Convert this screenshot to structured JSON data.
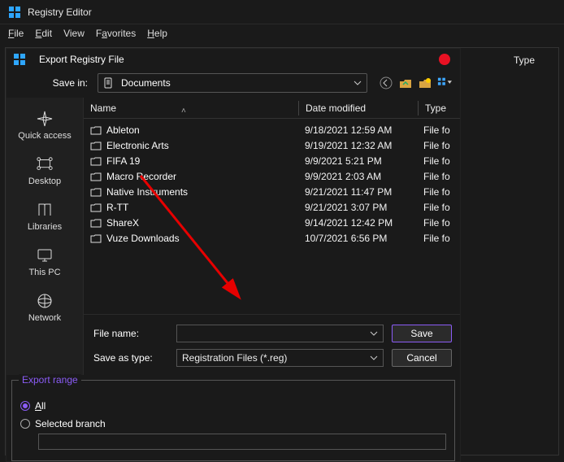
{
  "app": {
    "title": "Registry Editor"
  },
  "menu": {
    "file": "File",
    "edit": "Edit",
    "view": "View",
    "favorites": "Favorites",
    "help": "Help"
  },
  "dialog": {
    "title": "Export Registry File",
    "save_in_label": "Save in:",
    "save_in_value": "Documents",
    "columns": {
      "name": "Name",
      "date": "Date modified",
      "type": "Type"
    },
    "places": {
      "quick_access": "Quick access",
      "desktop": "Desktop",
      "libraries": "Libraries",
      "this_pc": "This PC",
      "network": "Network"
    },
    "rows": [
      {
        "name": "Ableton",
        "date": "9/18/2021 12:59 AM",
        "type": "File fo"
      },
      {
        "name": "Electronic Arts",
        "date": "9/19/2021 12:32 AM",
        "type": "File fo"
      },
      {
        "name": "FIFA 19",
        "date": "9/9/2021 5:21 PM",
        "type": "File fo"
      },
      {
        "name": "Macro Recorder",
        "date": "9/9/2021 2:03 AM",
        "type": "File fo"
      },
      {
        "name": "Native Instruments",
        "date": "9/21/2021 11:47 PM",
        "type": "File fo"
      },
      {
        "name": "R-TT",
        "date": "9/21/2021 3:07 PM",
        "type": "File fo"
      },
      {
        "name": "ShareX",
        "date": "9/14/2021 12:42 PM",
        "type": "File fo"
      },
      {
        "name": "Vuze Downloads",
        "date": "10/7/2021 6:56 PM",
        "type": "File fo"
      }
    ],
    "file_name_label": "File name:",
    "file_name_value": "",
    "save_as_type_label": "Save as type:",
    "save_as_type_value": "Registration Files (*.reg)",
    "save_btn": "Save",
    "cancel_btn": "Cancel",
    "export_range": {
      "legend": "Export range",
      "all": "All",
      "selected": "Selected branch",
      "branch_value": ""
    }
  },
  "right": {
    "type_col": "Type"
  }
}
